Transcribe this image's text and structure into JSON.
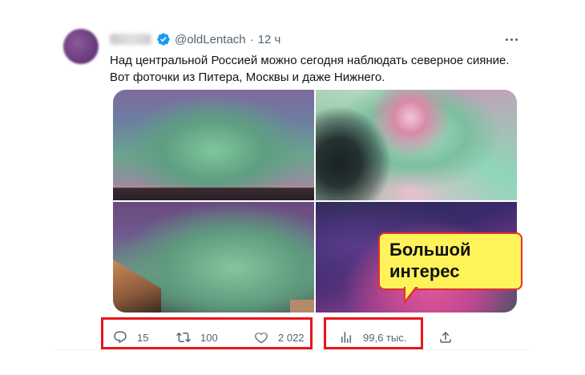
{
  "tweet": {
    "handle": "@oldLentach",
    "separator": "·",
    "time": "12 ч",
    "text_lines": [
      "Над центральной Россией можно сегодня наблюдать северное сияние.",
      "Вот фоточки из Питера, Москвы и даже Нижнего."
    ]
  },
  "actions": {
    "replies": "15",
    "retweets": "100",
    "likes": "2 022",
    "views": "99,6 тыс."
  },
  "callout": {
    "line1": "Большой",
    "line2": "интерес"
  },
  "colors": {
    "highlight_border": "#e8151b",
    "callout_fill": "#fff35a",
    "verified": "#1d9bf0"
  }
}
